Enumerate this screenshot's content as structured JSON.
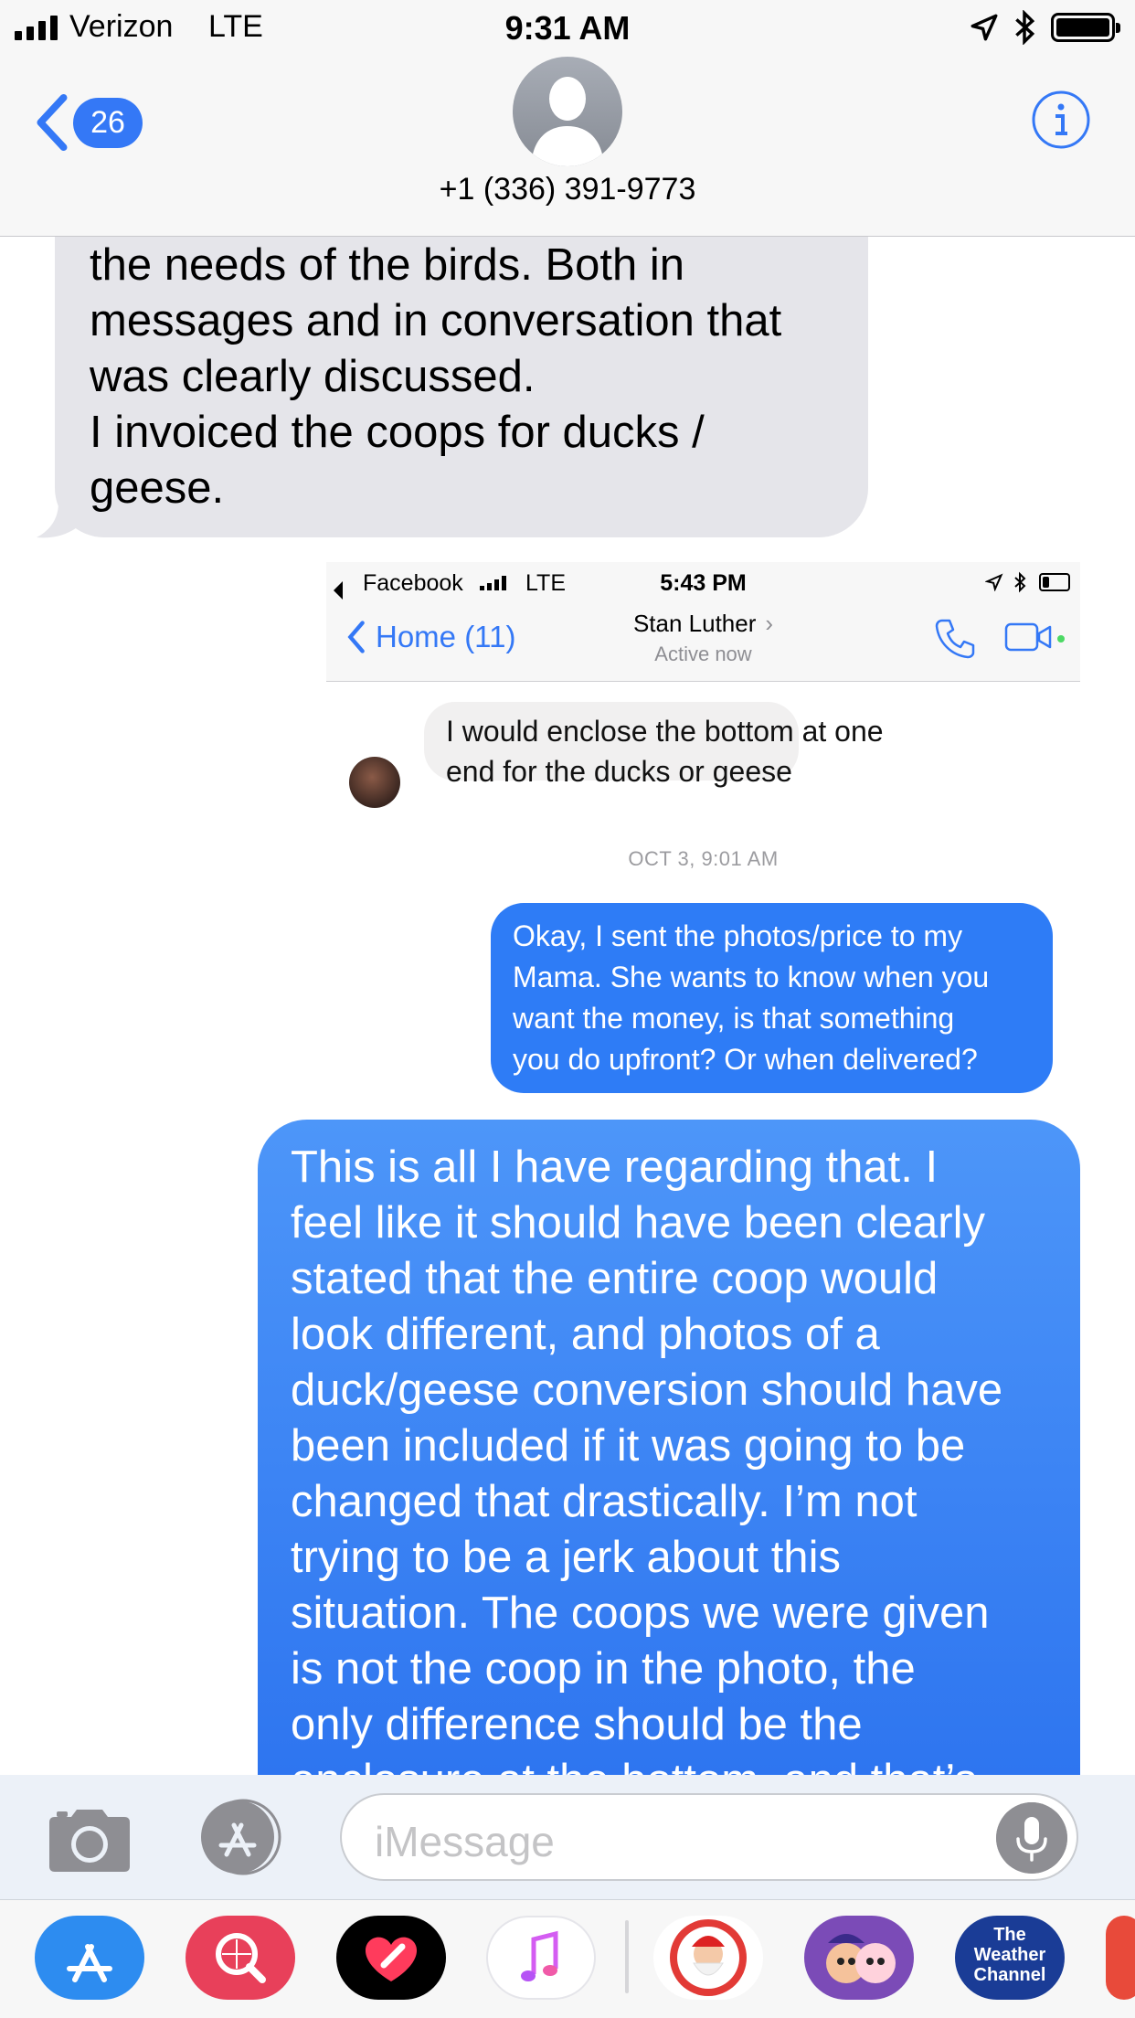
{
  "status_bar": {
    "carrier": "Verizon",
    "network": "LTE",
    "time": "9:31 AM",
    "battery_level": 1.0
  },
  "header": {
    "back_count": "26",
    "contact": "+1 (336) 391-9773"
  },
  "messages": {
    "received_lines": [
      "the needs of the birds. Both in",
      "messages and in conversation that",
      "was clearly discussed.",
      "I invoiced the coops for ducks /",
      "geese."
    ],
    "sent_lines": [
      "This is all I have regarding that. I",
      "feel like it should have been clearly",
      "stated that the entire coop would",
      "look different, and photos of a",
      "duck/geese conversion should have",
      "been included if it was going to be",
      "changed that drastically. I’m not",
      "trying to be a jerk about this",
      "situation. The coops we were given",
      "is not the coop in the photo, the",
      "only difference should be the",
      "enclosure at the bottom, and that’s"
    ]
  },
  "screenshot": {
    "back_app": "Facebook",
    "network": "LTE",
    "time": "5:43 PM",
    "battery_level": 0.35,
    "home_label": "Home (11)",
    "contact_name": "Stan Luther",
    "contact_status": "Active now",
    "received_lines": [
      "I would enclose the bottom at one",
      "end for the ducks or geese"
    ],
    "date_stamp": "OCT 3, 9:01 AM",
    "sent_lines": [
      "Okay, I sent the photos/price to my",
      "Mama. She wants to know when you",
      "want the money, is that something",
      "you do upfront? Or when delivered?"
    ]
  },
  "composer": {
    "placeholder": "iMessage"
  },
  "drawer": {
    "apps": [
      {
        "icon": "app-store-icon",
        "color": "#2d8cf0"
      },
      {
        "icon": "web-images-search-icon",
        "color": "#e8405a"
      },
      {
        "icon": "digital-touch-heart-icon",
        "color": "#000000"
      },
      {
        "icon": "music-icon",
        "color": "#ffffff"
      },
      {
        "icon": "santa-sticker-icon",
        "color": "#ffffff"
      },
      {
        "icon": "disney-stickers-icon",
        "color": "#7b4bb7"
      },
      {
        "icon": "weather-channel-icon",
        "color": "#1a3c96"
      }
    ],
    "weather_label": "The Weather Channel"
  },
  "colors": {
    "accent": "#3478f6",
    "received_bubble": "#e5e5ea",
    "sent_bubble": "#2e7cf6"
  }
}
